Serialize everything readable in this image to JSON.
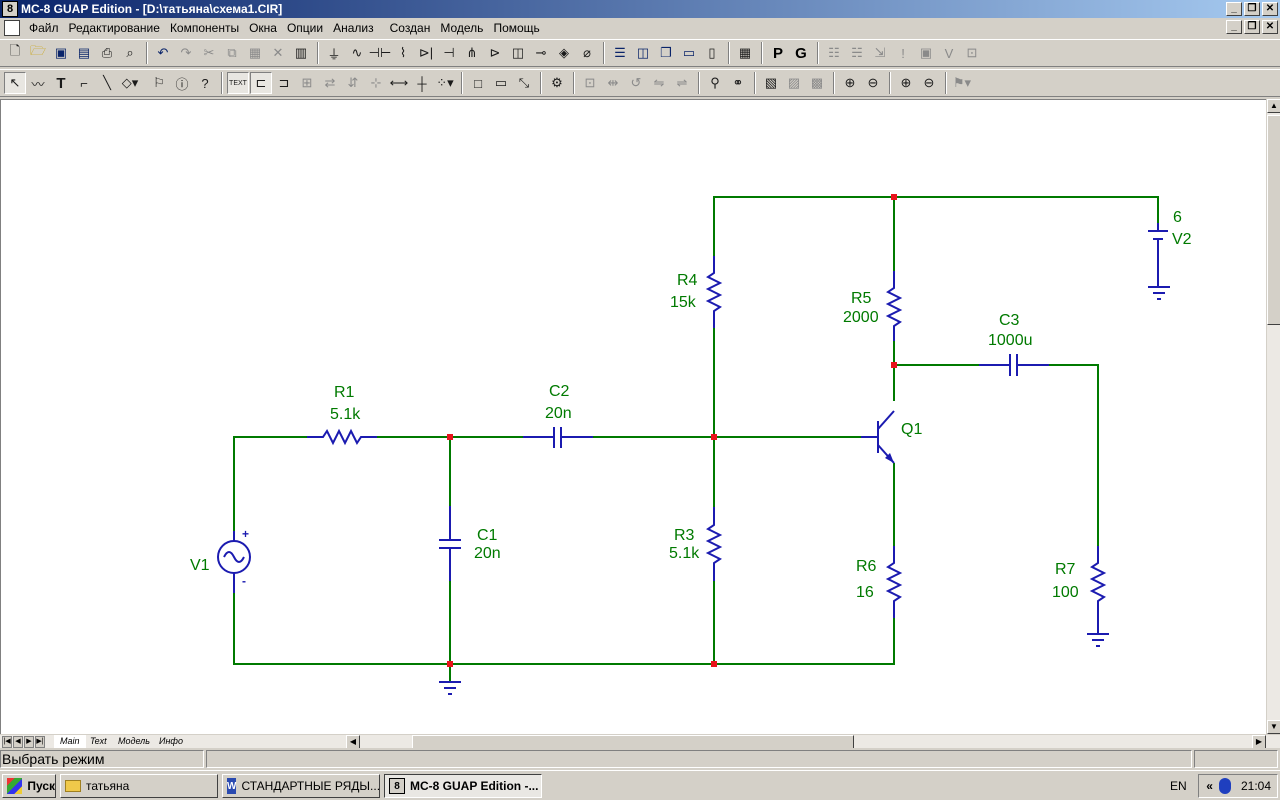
{
  "window": {
    "title": "MC-8 GUAP Edition - [D:\\татьяна\\схема1.CIR]",
    "app_icon": "8",
    "buttons": [
      "minimize-icon",
      "restore-icon",
      "close-icon"
    ]
  },
  "menu": {
    "items": [
      "Файл",
      "Редактирование",
      "Компоненты",
      "Окна",
      "Опции",
      "Анализ",
      "Создан",
      "Модель",
      "Помощь"
    ]
  },
  "toolbar1": {
    "text_p": "P",
    "text_g": "G"
  },
  "toolbar2": {
    "text_button": "TEXT"
  },
  "schematic": {
    "wire_color": "#007a00",
    "component_color": "#1b1bb0",
    "node_color": "#e8141c",
    "components": {
      "R1": {
        "name": "R1",
        "value": "5.1k"
      },
      "C2": {
        "name": "C2",
        "value": "20n"
      },
      "R4": {
        "name": "R4",
        "value": "15k"
      },
      "R5": {
        "name": "R5",
        "value": "2000"
      },
      "C3": {
        "name": "C3",
        "value": "1000u"
      },
      "V2": {
        "name": "V2",
        "value": "6"
      },
      "Q1": {
        "name": "Q1"
      },
      "C1": {
        "name": "C1",
        "value": "20n"
      },
      "R3": {
        "name": "R3",
        "value": "5.1k"
      },
      "R6": {
        "name": "R6",
        "value": "16"
      },
      "R7": {
        "name": "R7",
        "value": "100"
      },
      "V1": {
        "name": "V1",
        "plus": "+",
        "minus": "-"
      }
    }
  },
  "sheet_tabs": [
    "Main",
    "Text",
    "Модель",
    "Инфо"
  ],
  "status": {
    "mode_text": "Выбрать режим"
  },
  "taskbar": {
    "start_label": "Пуск",
    "tasks": [
      {
        "label": "татьяна",
        "icon": "folder-icon"
      },
      {
        "label": "СТАНДАРТНЫЕ РЯДЫ...",
        "icon": "word-icon"
      },
      {
        "label": "MC-8 GUAP Edition -...",
        "icon": "mc8-icon",
        "active": true
      }
    ],
    "language": "EN",
    "tray_arrows": "«",
    "clock": "21:04"
  }
}
